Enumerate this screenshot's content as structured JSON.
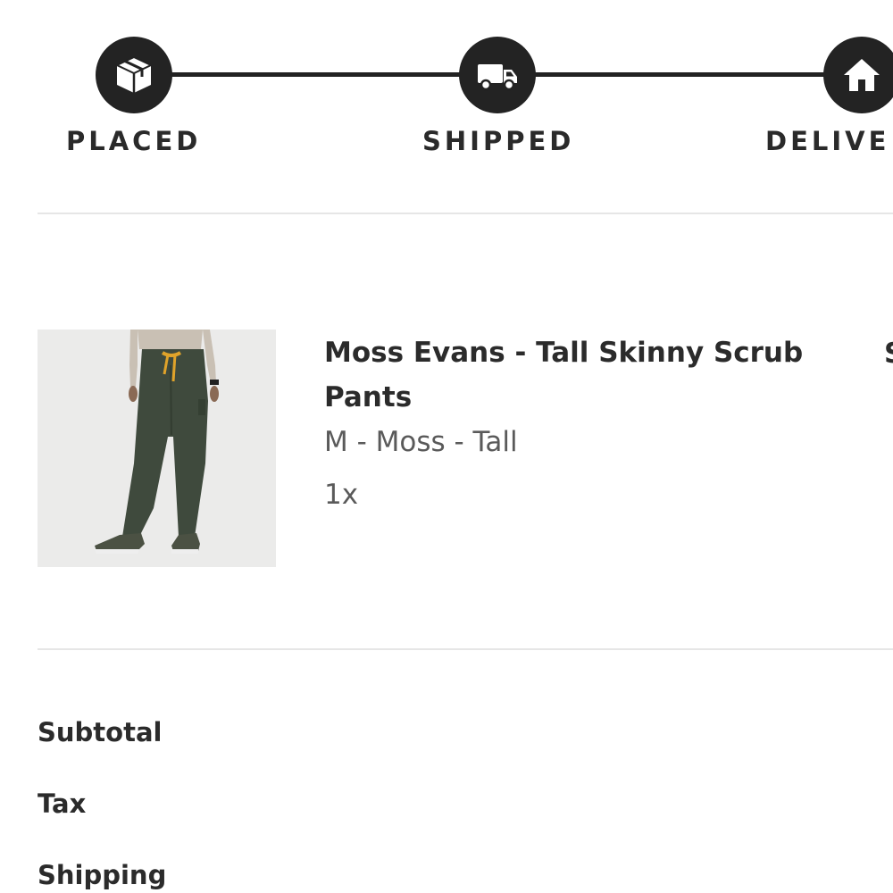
{
  "tracker": {
    "steps": [
      {
        "label": "PLACED",
        "icon": "package-icon"
      },
      {
        "label": "SHIPPED",
        "icon": "truck-icon"
      },
      {
        "label": "DELIVE",
        "icon": "house-icon"
      }
    ],
    "color": "#232323"
  },
  "product": {
    "name": "Moss Evans - Tall Skinny Scrub Pants",
    "variant": "M - Moss - Tall",
    "quantity": "1x",
    "pants_color": "#3f4a3d",
    "drawstring_color": "#e0a32a"
  },
  "clipped_text": "S",
  "summary": {
    "subtotal_label": "Subtotal",
    "tax_label": "Tax",
    "shipping_label": "Shipping"
  }
}
